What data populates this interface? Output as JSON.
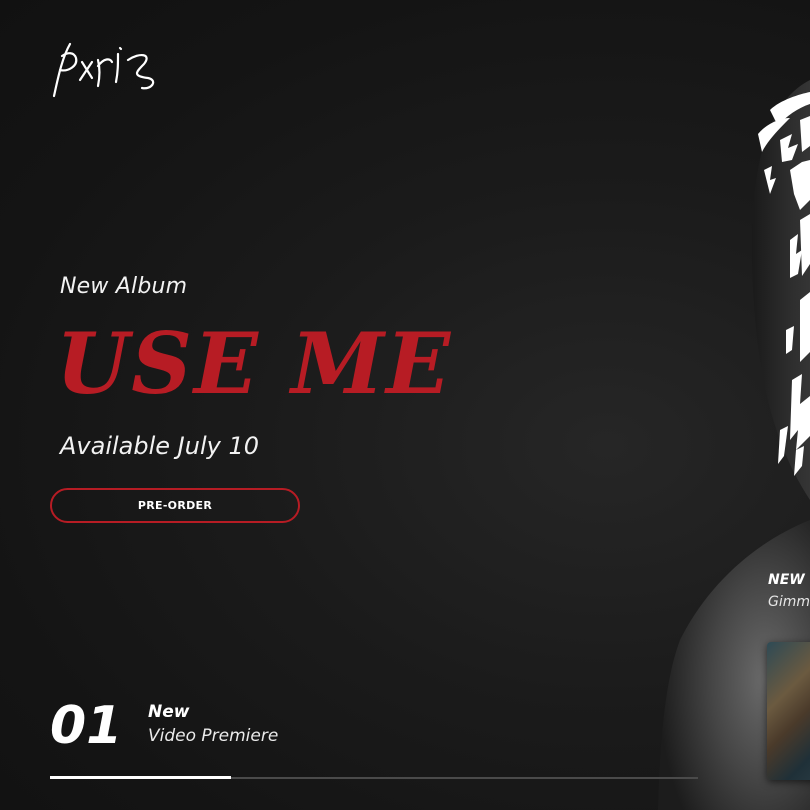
{
  "logo": {
    "name": "Kris signature logo"
  },
  "hero": {
    "eyebrow": "New Album",
    "title": "USE ME",
    "subtitle": "Available July 10",
    "cta_label": "PRE-ORDER"
  },
  "side_card": {
    "badge": "NEW",
    "name": "Gimm"
  },
  "slider": {
    "number": "01",
    "line1": "New",
    "line2": "Video Premiere",
    "progress": 0.28
  },
  "colors": {
    "accent": "#b71c24",
    "background": "#141414",
    "text": "#ffffff"
  }
}
